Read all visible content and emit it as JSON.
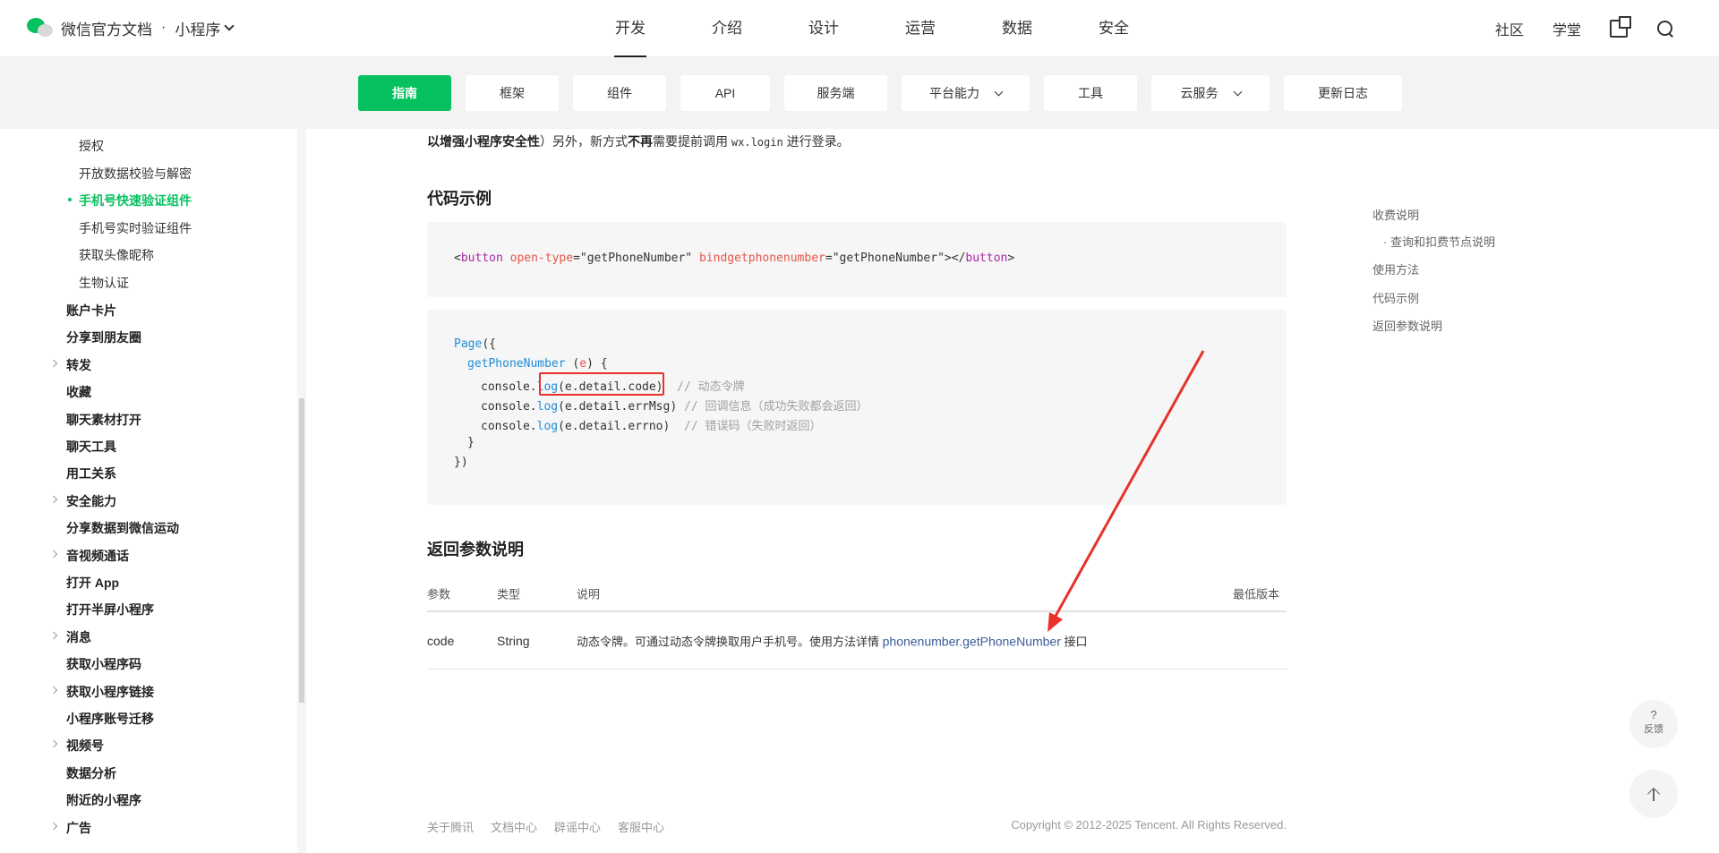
{
  "header": {
    "logo_text": "微信官方文档",
    "separator": "·",
    "product": "小程序",
    "nav": [
      "开发",
      "介绍",
      "设计",
      "运营",
      "数据",
      "安全"
    ],
    "active_nav": "开发",
    "community": "社区",
    "academy": "学堂"
  },
  "subnav": {
    "tabs": [
      {
        "label": "指南",
        "active": true,
        "dropdown": false,
        "width": 104
      },
      {
        "label": "框架",
        "active": false,
        "dropdown": false,
        "width": 104
      },
      {
        "label": "组件",
        "active": false,
        "dropdown": false,
        "width": 104
      },
      {
        "label": "API",
        "active": false,
        "dropdown": false,
        "width": 100
      },
      {
        "label": "服务端",
        "active": false,
        "dropdown": false,
        "width": 115
      },
      {
        "label": "平台能力",
        "active": false,
        "dropdown": true,
        "width": 143
      },
      {
        "label": "工具",
        "active": false,
        "dropdown": false,
        "width": 104
      },
      {
        "label": "云服务",
        "active": false,
        "dropdown": true,
        "width": 132
      },
      {
        "label": "更新日志",
        "active": false,
        "dropdown": false,
        "width": 132
      }
    ]
  },
  "sidebar": {
    "sub_items": [
      "授权",
      "开放数据校验与解密",
      "手机号快速验证组件",
      "手机号实时验证组件",
      "获取头像昵称",
      "生物认证"
    ],
    "active_sub": "手机号快速验证组件",
    "top_items": [
      {
        "label": "账户卡片",
        "expandable": false
      },
      {
        "label": "分享到朋友圈",
        "expandable": false
      },
      {
        "label": "转发",
        "expandable": true
      },
      {
        "label": "收藏",
        "expandable": false
      },
      {
        "label": "聊天素材打开",
        "expandable": false
      },
      {
        "label": "聊天工具",
        "expandable": false
      },
      {
        "label": "用工关系",
        "expandable": false
      },
      {
        "label": "安全能力",
        "expandable": true
      },
      {
        "label": "分享数据到微信运动",
        "expandable": false
      },
      {
        "label": "音视频通话",
        "expandable": true
      },
      {
        "label": "打开 App",
        "expandable": false
      },
      {
        "label": "打开半屏小程序",
        "expandable": false
      },
      {
        "label": "消息",
        "expandable": true
      },
      {
        "label": "获取小程序码",
        "expandable": false
      },
      {
        "label": "获取小程序链接",
        "expandable": true
      },
      {
        "label": "小程序账号迁移",
        "expandable": false
      },
      {
        "label": "视频号",
        "expandable": true
      },
      {
        "label": "数据分析",
        "expandable": false
      },
      {
        "label": "附近的小程序",
        "expandable": false
      },
      {
        "label": "广告",
        "expandable": true
      }
    ]
  },
  "content": {
    "intro": {
      "part1": "以增强小程序安全性",
      "part2": "）另外，新方式",
      "part3": "不再",
      "part4": "需要提前调用 ",
      "code": "wx.login",
      "part5": " 进行登录。"
    },
    "section_code": "代码示例",
    "code1": {
      "open": "<",
      "tag": "button",
      "attr1": "open-type",
      "eq": "=",
      "val1": "\"getPhoneNumber\"",
      "attr2": "bindgetphonenumber",
      "val2": "\"getPhoneNumber\"",
      "close": "></",
      "end": ">"
    },
    "code2": {
      "l1_fn": "Page",
      "l1_rest": "({",
      "l2_fn": "getPhoneNumber",
      "l2_open": " (",
      "l2_param": "e",
      "l2_close": ") {",
      "console": "console.",
      "log": "log",
      "arg1": "(e.detail.code)",
      "cmt1": "// 动态令牌",
      "arg2": "(e.detail.errMsg)",
      "cmt2": "// 回调信息（成功失败都会返回）",
      "arg3": "(e.detail.errno)",
      "cmt3": "// 错误码（失败时返回）",
      "l6": "}",
      "l7": "})"
    },
    "section_return": "返回参数说明",
    "table": {
      "headers": [
        "参数",
        "类型",
        "说明",
        "最低版本"
      ],
      "rows": [
        {
          "param": "code",
          "type": "String",
          "desc": "动态令牌。可通过动态令牌换取用户手机号。使用方法详情 ",
          "link": "phonenumber.getPhoneNumber",
          "desc_tail": " 接口"
        }
      ]
    }
  },
  "toc": [
    "收费说明",
    "· 查询和扣费节点说明",
    "使用方法",
    "代码示例",
    "返回参数说明"
  ],
  "footer": {
    "links": [
      "关于腾讯",
      "文档中心",
      "辟谣中心",
      "客服中心"
    ],
    "copyright": "Copyright © 2012-2025 Tencent. All Rights Reserved."
  },
  "float": {
    "feedback_q": "?",
    "feedback": "反馈"
  },
  "colors": {
    "brand": "#07c160",
    "annotation": "#e8312a",
    "link": "#3b5c9a"
  }
}
